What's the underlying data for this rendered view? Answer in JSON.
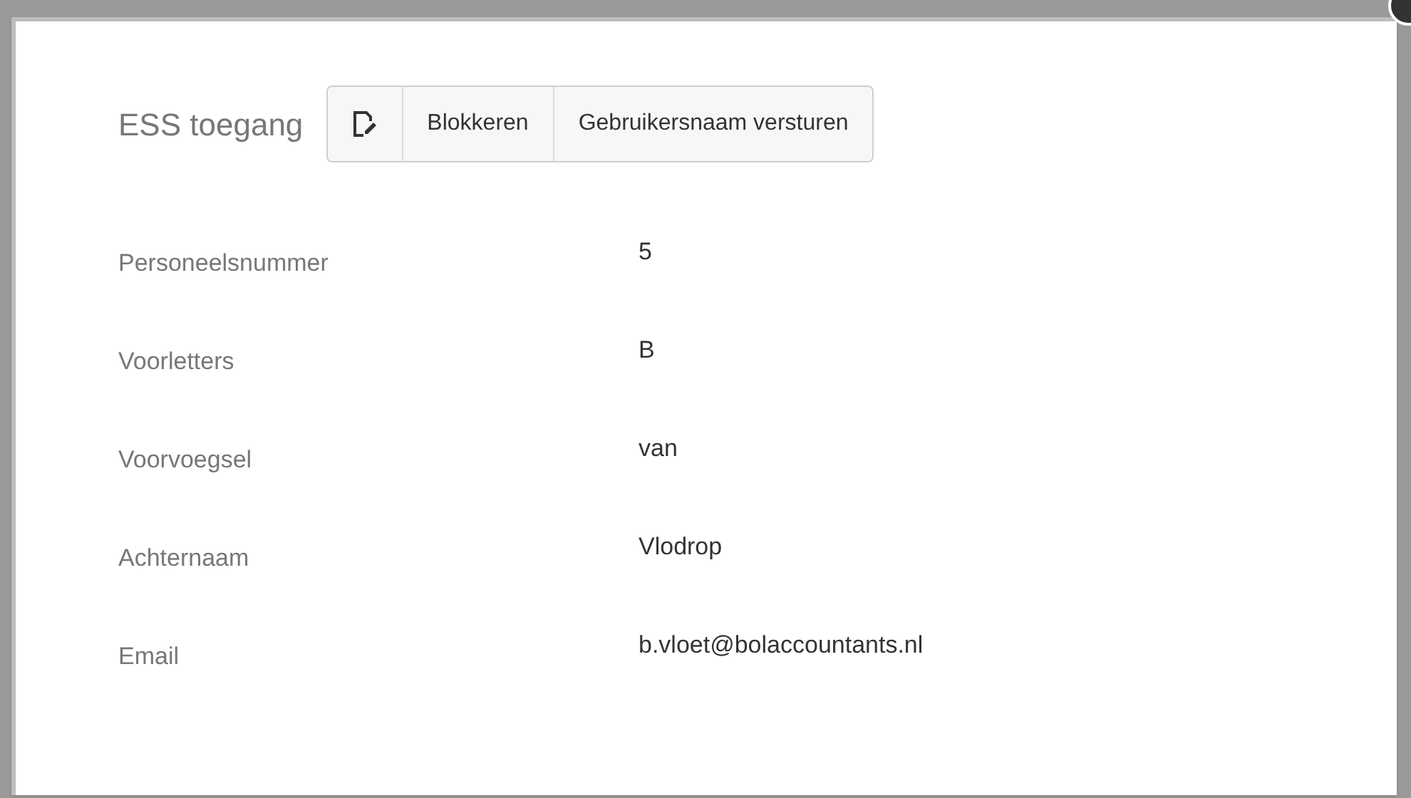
{
  "title": "ESS toegang",
  "buttons": [
    {
      "kind": "icon"
    },
    {
      "kind": "text",
      "label": "Blokkeren"
    },
    {
      "kind": "text",
      "label": "Gebruikersnaam versturen"
    }
  ],
  "fields": [
    {
      "label": "Personeelsnummer",
      "value": "5"
    },
    {
      "label": "Voorletters",
      "value": "B"
    },
    {
      "label": "Voorvoegsel",
      "value": "van"
    },
    {
      "label": "Achternaam",
      "value": "Vlodrop"
    },
    {
      "label": "Email",
      "value": "b.vloet@bolaccountants.nl"
    }
  ]
}
